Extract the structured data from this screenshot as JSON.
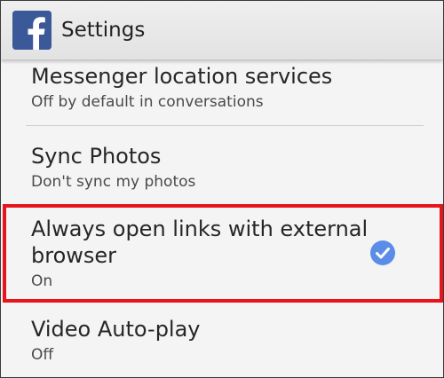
{
  "app_bar": {
    "logo_icon": "facebook-logo-icon",
    "title": "Settings"
  },
  "settings": [
    {
      "title": "Messenger location services",
      "subtitle": "Off by default in conversations"
    },
    {
      "title": "Sync Photos",
      "subtitle": "Don't sync my photos"
    },
    {
      "title_line1": "Always open links with external",
      "title_line2": "browser",
      "subtitle": "On",
      "checked": true,
      "highlighted": true
    },
    {
      "title": "Video Auto-play",
      "subtitle": "Off"
    }
  ],
  "colors": {
    "facebook_blue": "#3b5998",
    "check_blue": "#5b8de8",
    "highlight_red": "#e8141c"
  }
}
